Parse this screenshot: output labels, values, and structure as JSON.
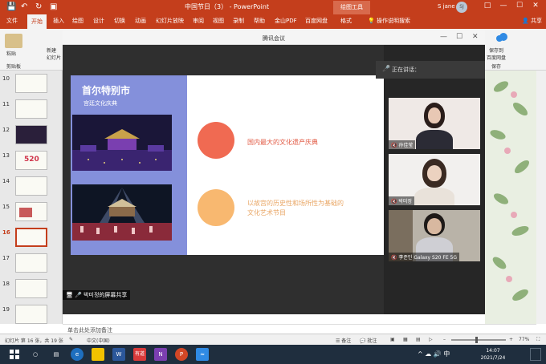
{
  "app": {
    "doc_title": "中国节日（3） - PowerPoint",
    "drawing_tools": "绘图工具",
    "user_name": "S jane",
    "user_initials": "SJ",
    "share_label": "共享",
    "search_hint": "操作说明搜索"
  },
  "ribbon": {
    "tabs": [
      "文件",
      "开始",
      "插入",
      "绘图",
      "设计",
      "切换",
      "动画",
      "幻灯片放映",
      "审阅",
      "视图",
      "录制",
      "帮助",
      "金山PDF",
      "百度网盘",
      "格式"
    ],
    "active_tab": "开始",
    "paste_label": "粘贴",
    "clipboard_label": "剪贴板",
    "new_slide_label": "新建\n幻灯片",
    "save_to_label": "保存到\n百度网盘",
    "save_label": "保存"
  },
  "slides": {
    "numbers": [
      "10",
      "11",
      "12",
      "13",
      "14",
      "15",
      "16",
      "17",
      "18",
      "19"
    ],
    "active": "16",
    "thumb_520": "520"
  },
  "meeting": {
    "title": "腾讯会议",
    "speaking_label": "正在讲话：",
    "share_banner": "박미정的屏幕共享",
    "participants": [
      {
        "name": "孙佳莹"
      },
      {
        "name": "박미정"
      },
      {
        "name": "李준민 Galaxy S20 FE 5G"
      }
    ]
  },
  "shared_slide": {
    "title": "首尔特别市",
    "subtitle": "宫廷文化庆典",
    "point1": "国内最大的文化遗产庆典",
    "point2_line1": "以故宫的历史性和场所性为基础的",
    "point2_line2": "文化艺术节目",
    "colors": {
      "panel": "#8490db",
      "circle1": "#f06a52",
      "circle2": "#f8b870",
      "text1": "#e25b45",
      "text2": "#e9a766"
    }
  },
  "notes": {
    "placeholder": "单击此处添加备注"
  },
  "status": {
    "slide_count": "幻灯片 第 16 张，共 19 张",
    "language": "中文(中国)",
    "notes_btn": "备注",
    "comments_btn": "批注",
    "zoom": "77%"
  },
  "taskbar": {
    "time": "14:07",
    "date": "2021/7/24",
    "word_icon_label": "W",
    "ppt_icon_label": "P",
    "red_app_label": "有道"
  }
}
